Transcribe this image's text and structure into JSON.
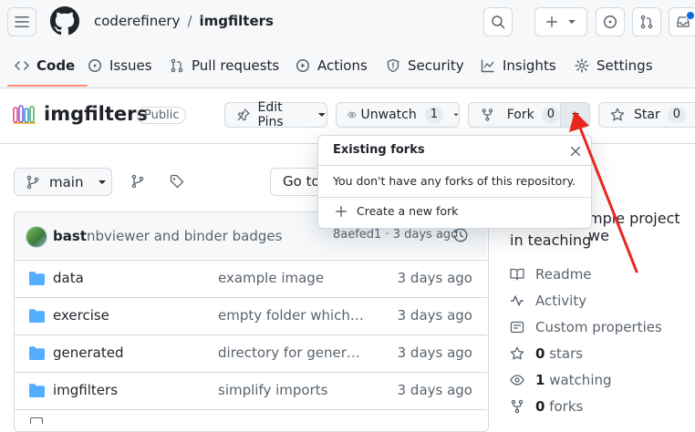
{
  "header": {
    "owner": "coderefinery",
    "separator": "/",
    "repo": "imgfilters"
  },
  "tabs": [
    {
      "label": "Code",
      "icon": "code-icon"
    },
    {
      "label": "Issues",
      "icon": "issue-icon"
    },
    {
      "label": "Pull requests",
      "icon": "pull-request-icon"
    },
    {
      "label": "Actions",
      "icon": "play-icon"
    },
    {
      "label": "Security",
      "icon": "shield-icon"
    },
    {
      "label": "Insights",
      "icon": "graph-icon"
    },
    {
      "label": "Settings",
      "icon": "gear-icon"
    }
  ],
  "repo_bar": {
    "name": "imgfilters",
    "visibility": "Public",
    "edit_pins": "Edit Pins",
    "unwatch": "Unwatch",
    "watch_count": "1",
    "fork": "Fork",
    "fork_count": "0",
    "star": "Star",
    "star_count": "0"
  },
  "fork_popup": {
    "title": "Existing forks",
    "message": "You don't have any forks of this repository.",
    "create": "Create a new fork"
  },
  "branch": {
    "name": "main",
    "goto": "Go to"
  },
  "commit": {
    "author": "bast",
    "message": "nbviewer and binder badges",
    "meta": "8aefed1 · 3 days ago"
  },
  "files": [
    {
      "name": "data",
      "message": "example image",
      "date": "3 days ago"
    },
    {
      "name": "exercise",
      "message": "empty folder which w...",
      "date": "3 days ago"
    },
    {
      "name": "generated",
      "message": "directory for generate...",
      "date": "3 days ago"
    },
    {
      "name": "imgfilters",
      "message": "simplify imports",
      "date": "3 days ago"
    }
  ],
  "about": {
    "line1": "mple project we",
    "line2": "in teaching",
    "readme": "Readme",
    "activity": "Activity",
    "custom": "Custom properties",
    "stars_count": "0",
    "stars_label": "stars",
    "watching_count": "1",
    "watching_label": "watching",
    "forks_count": "0",
    "forks_label": "forks"
  },
  "colors": {
    "accent": "#fd8c73",
    "link": "#0969da",
    "arrow": "#e8261f",
    "folder": "#54aeff"
  }
}
